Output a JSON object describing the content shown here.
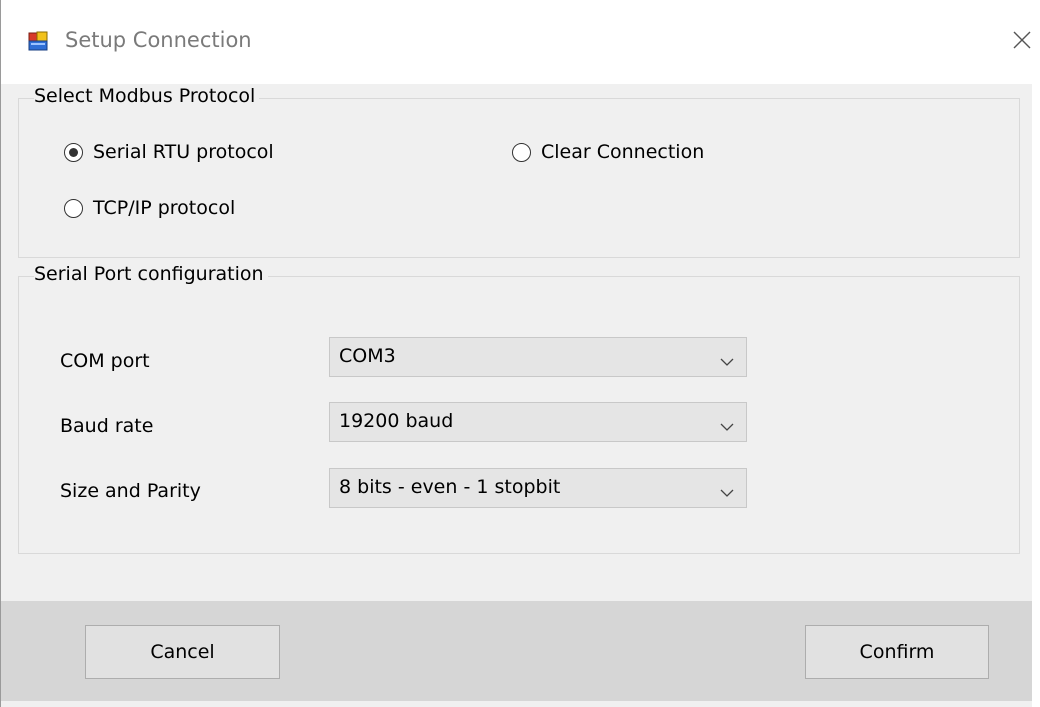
{
  "window": {
    "title": "Setup Connection",
    "icon": "app-window-icon",
    "close_icon": "close-icon"
  },
  "protocol_group": {
    "caption": "Select Modbus Protocol",
    "options": [
      {
        "label": "Serial RTU protocol",
        "selected": true
      },
      {
        "label": "Clear Connection",
        "selected": false
      },
      {
        "label": "TCP/IP protocol",
        "selected": false
      }
    ]
  },
  "serial_group": {
    "caption": "Serial Port configuration",
    "fields": [
      {
        "label": "COM port",
        "value": "COM3"
      },
      {
        "label": "Baud rate",
        "value": "19200 baud"
      },
      {
        "label": "Size and Parity",
        "value": "8 bits - even - 1 stopbit"
      }
    ]
  },
  "buttons": {
    "cancel": "Cancel",
    "confirm": "Confirm"
  },
  "colors": {
    "window_bg": "#f0f0f0",
    "footer_bg": "#d6d6d6",
    "combo_bg": "#e5e5e5",
    "button_bg": "#e1e1e1"
  }
}
